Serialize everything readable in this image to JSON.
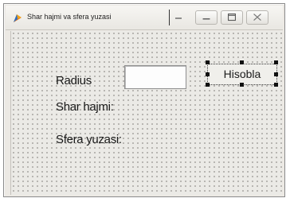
{
  "window": {
    "title": "Shar hajmi va sfera yuzasi",
    "buttons": [
      "minimize",
      "maximize",
      "close"
    ]
  },
  "form": {
    "radius_label": "Radius",
    "radius_value": "",
    "shar_hajmi_label": "Shar hajmi:",
    "sfera_yuzasi_label": "Sfera yuzasi:",
    "hisobla_label": "Hisobla"
  }
}
